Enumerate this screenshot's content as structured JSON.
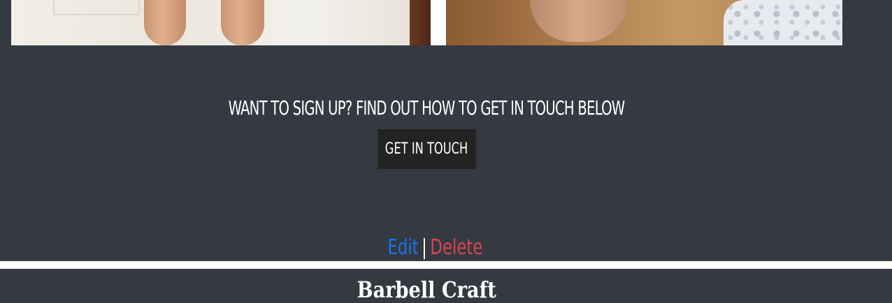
{
  "cta": {
    "heading": "WANT TO SIGN UP? FIND OUT HOW TO GET IN TOUCH BELOW",
    "button_label": "GET IN TOUCH"
  },
  "admin": {
    "edit_label": "Edit",
    "separator": "|",
    "delete_label": "Delete"
  },
  "next_section": {
    "title": "Barbell Craft"
  },
  "colors": {
    "background": "#353a42",
    "button_bg": "#232323",
    "edit_link": "#1a73e8",
    "delete_link": "#d9434f"
  }
}
